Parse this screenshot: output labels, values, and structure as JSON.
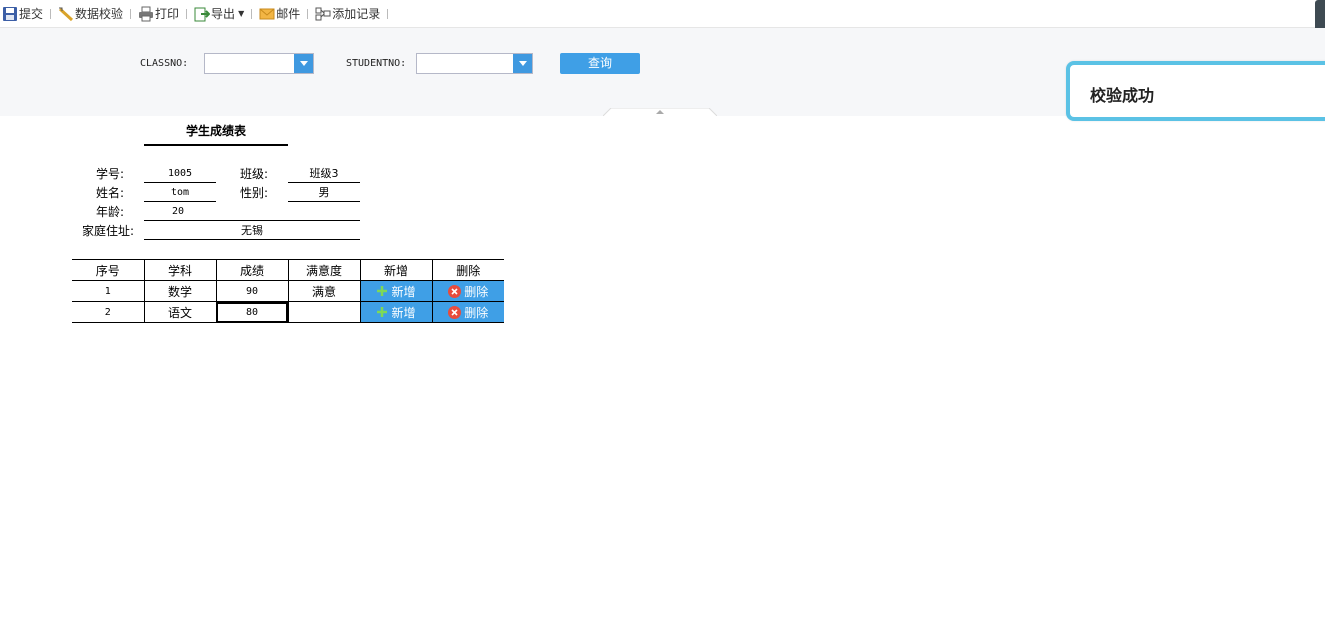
{
  "toolbar": {
    "submit": "提交",
    "validate": "数据校验",
    "print": "打印",
    "export": "导出",
    "mail": "邮件",
    "add_record": "添加记录"
  },
  "params": {
    "classno_label": "CLASSNO:",
    "studentno_label": "STUDENTNO:",
    "query_label": "查询"
  },
  "toast": {
    "message": "校验成功"
  },
  "report": {
    "title": "学生成绩表",
    "student_no_label": "学号:",
    "student_no": "1005",
    "class_label": "班级:",
    "class_value": "班级3",
    "name_label": "姓名:",
    "name_value": "tom",
    "gender_label": "性别:",
    "gender_value": "男",
    "age_label": "年龄:",
    "age_value": "20",
    "address_label": "家庭住址:",
    "address_value": "无锡"
  },
  "grid": {
    "headers": [
      "序号",
      "学科",
      "成绩",
      "满意度",
      "新增",
      "删除"
    ],
    "rows": [
      {
        "seq": "1",
        "subject": "数学",
        "score": "90",
        "satisfaction": "满意",
        "add": "新增",
        "delete": "删除"
      },
      {
        "seq": "2",
        "subject": "语文",
        "score": "80",
        "satisfaction": "",
        "add": "新增",
        "delete": "删除"
      }
    ]
  },
  "colors": {
    "accent": "#3f9fe6",
    "toast_border": "#5bc2e5",
    "add_icon": "#4caf50",
    "delete_icon": "#e84c3d"
  }
}
